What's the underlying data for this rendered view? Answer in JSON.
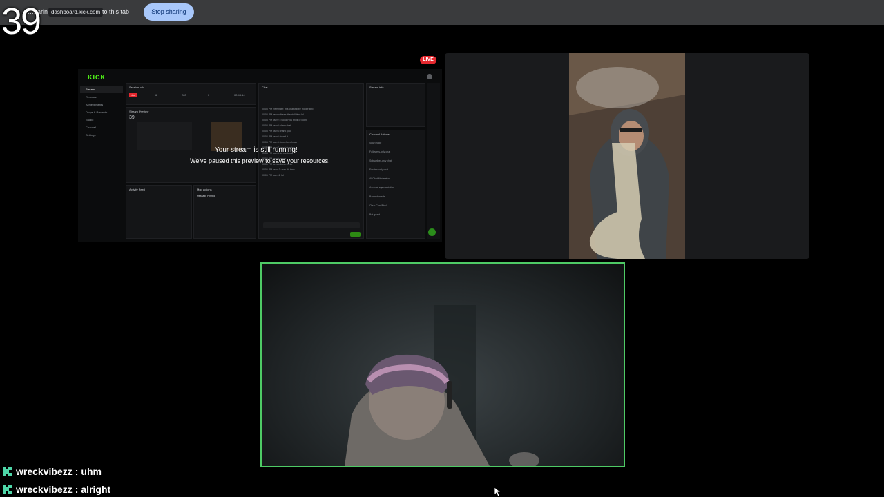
{
  "share_bar": {
    "sharing_text": "…haring",
    "host": "dashboard.kick.com",
    "suffix": "to this tab",
    "stop_label": "Stop sharing",
    "stop_color": "#a8c7fa"
  },
  "counter": "39",
  "dashboard": {
    "logo": "KICK",
    "nav": [
      "Stream",
      "Revenue",
      "Achievements",
      "Drops & Rewards",
      "Studio",
      "Channel",
      "Settings"
    ],
    "session_title": "Session info",
    "session_status": "Live",
    "session_stats": [
      "6",
      "283",
      "0",
      "00:43:14"
    ],
    "preview_title": "Stream Preview",
    "preview_number": "39",
    "running_message": "Your stream is still running!",
    "paused_message": "We've paused this preview to save your resources.",
    "chat_title": "Chat",
    "activity_title": "Activity Feed",
    "mod_actions_title": "Mod actions",
    "mod_action_item": "Message Pinned",
    "stream_info_title": "Stream info",
    "channel_actions_title": "Channel Actions",
    "channel_actions": [
      "Slow mode",
      "Followers-only chat",
      "Subscriber-only chat",
      "Emotes-only chat",
      "AI Chat Moderation",
      "Account age restriction",
      "Banned words",
      "Clear Chat/Find",
      "Bot guard"
    ],
    "chat_lines": [
      "00:03 PM Reminder: this chat will be moderated",
      "00:03 PM wreckvibezz: the chill time lol",
      "00:03 PM user2: i would you think of going",
      "00:03 PM user3: damn that",
      "00:03 PM user4: thank you",
      "00:04 PM user5: loved it",
      "00:04 PM user6: been here lmao",
      "00:04 PM user7: good evening",
      "00:04 PM user8: let me know",
      "00:04 PM user9: wooo",
      "00:05 PM wreckvibezz: hello",
      "00:05 PM user10: now it's time",
      "00:05 PM user11: lol"
    ],
    "live_label": "LIVE",
    "live_color": "#e5282f"
  },
  "chat_overlay": {
    "messages": [
      {
        "user": "wreckvibezz",
        "text": "uhm"
      },
      {
        "user": "wreckvibezz",
        "text": "alright"
      }
    ],
    "icon_color": "#4ed6a8"
  },
  "host_border_color": "#4eca65"
}
